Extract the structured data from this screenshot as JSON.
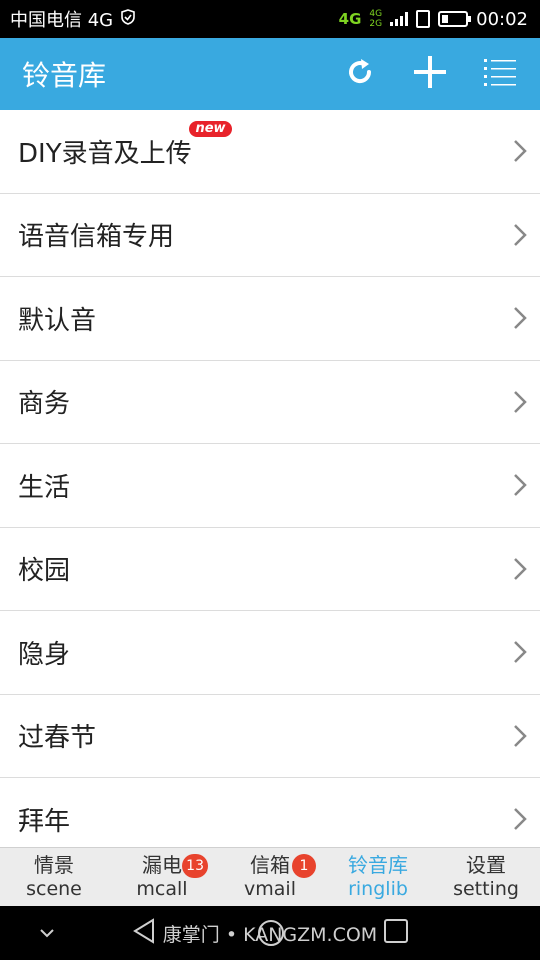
{
  "status_bar": {
    "carrier": "中国电信 4G",
    "network_4g": "4G",
    "network_stack_top": "4G",
    "network_stack_bottom": "2G",
    "time": "00:02"
  },
  "app_bar": {
    "title": "铃音库",
    "icons": [
      "refresh-icon",
      "add-icon",
      "menu-list-icon"
    ]
  },
  "list": {
    "items": [
      {
        "label": "DIY录音及上传",
        "badge": "new"
      },
      {
        "label": "语音信箱专用"
      },
      {
        "label": "默认音"
      },
      {
        "label": "商务"
      },
      {
        "label": "生活"
      },
      {
        "label": "校园"
      },
      {
        "label": "隐身"
      },
      {
        "label": "过春节"
      },
      {
        "label": "拜年"
      }
    ]
  },
  "tabs": [
    {
      "label": "情景",
      "sub": "scene"
    },
    {
      "label": "漏电",
      "sub": "mcall",
      "badge": "13"
    },
    {
      "label": "信箱",
      "sub": "vmail",
      "badge": "1"
    },
    {
      "label": "铃音库",
      "sub": "ringlib",
      "active": true
    },
    {
      "label": "设置",
      "sub": "setting"
    }
  ],
  "nav_bar": {
    "watermark": "康掌门 • KANGZM.COM"
  },
  "colors": {
    "accent": "#39a9e0",
    "badge_red": "#e8432d",
    "new_badge": "#e8232b",
    "network_green": "#7ed321"
  }
}
